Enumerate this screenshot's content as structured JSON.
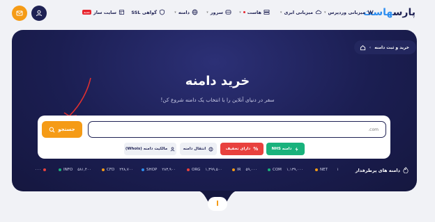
{
  "nav": {
    "logo_main": "پارس",
    "logo_accent": "هاست",
    "items": [
      {
        "label": "میزبانی وردپرس",
        "icon": "wordpress-icon"
      },
      {
        "label": "میزبانی ابری",
        "icon": "cloud-icon"
      },
      {
        "label": "هاست",
        "icon": "server-icon"
      },
      {
        "label": "سرور",
        "icon": "server-rack-icon"
      },
      {
        "label": "دامنه",
        "icon": "globe-icon"
      },
      {
        "label": "گواهی SSL",
        "icon": "shield-icon"
      },
      {
        "label": "سایت ساز",
        "icon": "builder-icon",
        "badge": "جدید"
      }
    ]
  },
  "breadcrumb": {
    "current": "خرید و ثبت دامنه"
  },
  "hero": {
    "title": "خرید دامنه",
    "subtitle": "سفر در دنیای آنلاین را با انتخاب یک دامنه شروع کن!"
  },
  "search": {
    "placeholder": ".com",
    "button_label": "جستجو"
  },
  "chips": [
    {
      "label": "دامنه NHS",
      "style": "green",
      "icon": "bolt-icon"
    },
    {
      "label": "دارای تخفیف",
      "style": "red",
      "icon": "percent-icon"
    },
    {
      "label": "انتقال دامنه",
      "style": "gray",
      "icon": "globe-icon"
    },
    {
      "label": "مالکیت دامنه (Whois)",
      "style": "gray",
      "icon": "user-icon"
    }
  ],
  "ticker": {
    "label": "دامنه های پرطرفدار",
    "items": [
      {
        "tld": "NET",
        "price": "۱",
        "color": "#f59b16"
      },
      {
        "tld": "COM",
        "price": "۱,۱۳۹,۰۰۰",
        "color": "#19b27c"
      },
      {
        "tld": "IR",
        "price": "۵۹,۰۰۰",
        "color": "#f59b16"
      },
      {
        "tld": "ORG",
        "price": "۱,۳۹۹,۵۰۰",
        "color": "#e8413e"
      },
      {
        "tld": "SHOP",
        "price": "۲۸۳,۹۰۰",
        "color": "#2d8ef0"
      },
      {
        "tld": "CFD",
        "price": "۲۴۸,۷۰۰",
        "color": "#f59b16"
      },
      {
        "tld": "INFO",
        "price": "۵۸۱,۴۰۰",
        "color": "#19b27c"
      },
      {
        "tld": "",
        "price": "۰۰۰",
        "color": "#e8413e"
      }
    ]
  },
  "colors": {
    "accent": "#f59b16",
    "navy": "#1f2254",
    "green": "#19b27c",
    "red": "#e8413e"
  }
}
